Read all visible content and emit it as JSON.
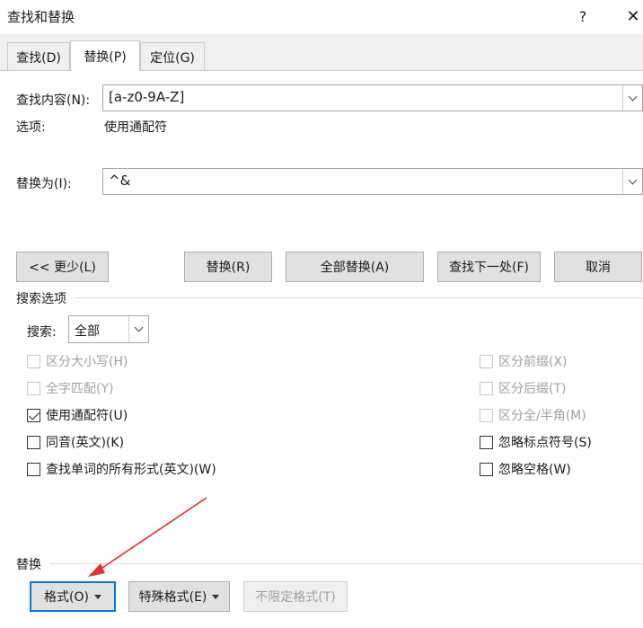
{
  "window": {
    "title": "查找和替换",
    "help": "?",
    "close": "✕"
  },
  "tabs": [
    {
      "label": "查找(D)"
    },
    {
      "label": "替换(P)"
    },
    {
      "label": "定位(G)"
    }
  ],
  "find": {
    "label": "查找内容(N):",
    "value": "[a-z0-9A-Z]"
  },
  "options": {
    "label": "选项:",
    "value": "使用通配符"
  },
  "replace": {
    "label": "替换为(I):",
    "value": "^&"
  },
  "buttons": {
    "less": "<< 更少(L)",
    "replace": "替换(R)",
    "replace_all": "全部替换(A)",
    "find_next": "查找下一处(F)",
    "cancel": "取消"
  },
  "search_options": {
    "title": "搜索选项",
    "search_label": "搜索:",
    "search_value": "全部",
    "left": [
      {
        "label": "区分大小写(H)",
        "checked": false,
        "disabled": true
      },
      {
        "label": "全字匹配(Y)",
        "checked": false,
        "disabled": true
      },
      {
        "label": "使用通配符(U)",
        "checked": true,
        "disabled": false
      },
      {
        "label": "同音(英文)(K)",
        "checked": false,
        "disabled": false
      },
      {
        "label": "查找单词的所有形式(英文)(W)",
        "checked": false,
        "disabled": false
      }
    ],
    "right": [
      {
        "label": "区分前缀(X)",
        "checked": false,
        "disabled": true
      },
      {
        "label": "区分后缀(T)",
        "checked": false,
        "disabled": true
      },
      {
        "label": "区分全/半角(M)",
        "checked": false,
        "disabled": true
      },
      {
        "label": "忽略标点符号(S)",
        "checked": false,
        "disabled": false
      },
      {
        "label": "忽略空格(W)",
        "checked": false,
        "disabled": false
      }
    ]
  },
  "replace_section": {
    "title": "替换",
    "format": "格式(O)",
    "special": "特殊格式(E)",
    "no_format": "不限定格式(T)"
  },
  "colors": {
    "annotation_arrow": "#e03030",
    "focus": "#0078d7"
  }
}
